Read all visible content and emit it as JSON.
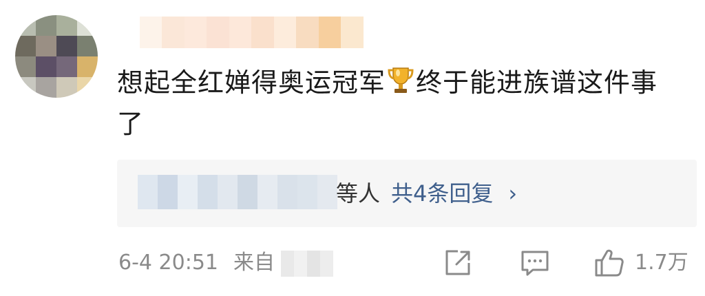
{
  "comment": {
    "text_part1": "想起全红婵得奥运冠军",
    "emoji_icon": "trophy-icon",
    "text_part2": "终于能进族谱这件事了"
  },
  "replies": {
    "trailing_text": "等人",
    "link_text": "共4条回复",
    "chevron": "›"
  },
  "footer": {
    "timestamp": "6-4 20:51",
    "source_prefix": "来自",
    "like_count": "1.7万"
  },
  "colors": {
    "link": "#3f5f8c",
    "meta": "#8a8a8a",
    "reply_bg": "#f6f6f6"
  }
}
